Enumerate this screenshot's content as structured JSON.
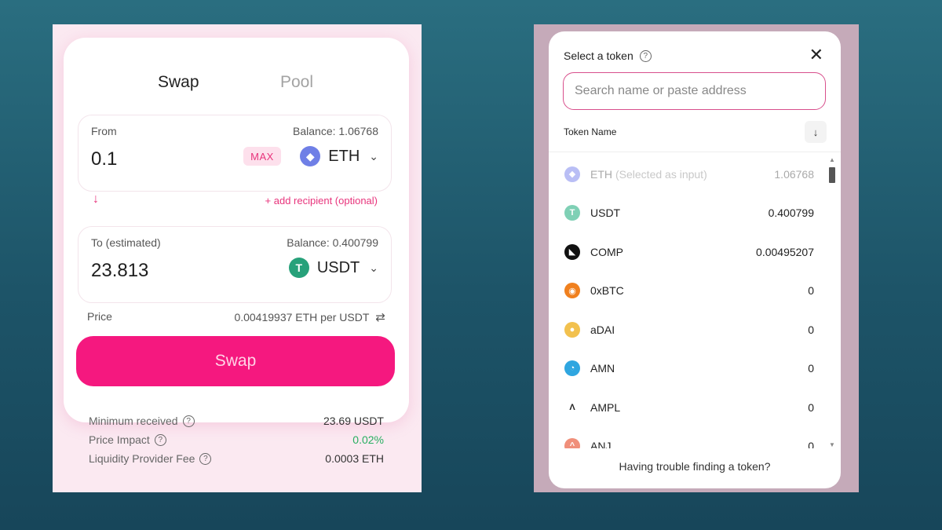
{
  "swap": {
    "tabs": [
      {
        "label": "Swap"
      },
      {
        "label": "Pool"
      }
    ],
    "from": {
      "label": "From",
      "balance": "Balance: 1.06768",
      "amount": "0.1",
      "max_label": "MAX",
      "token": "ETH",
      "token_icon": "eth-icon",
      "token_color": "#6f7fe6"
    },
    "arrow_icon": "arrow-down-icon",
    "add_recipient": "+ add recipient (optional)",
    "to": {
      "label": "To (estimated)",
      "balance": "Balance: 0.400799",
      "amount": "23.813",
      "token": "USDT",
      "token_icon": "usdt-icon",
      "token_color": "#27a17a"
    },
    "price": {
      "label": "Price",
      "value": "0.00419937 ETH per USDT"
    },
    "swap_button": "Swap",
    "accent_color": "#f5187f",
    "summary": [
      {
        "label": "Minimum received",
        "value": "23.69 USDT"
      },
      {
        "label": "Price Impact",
        "value": "0.02%"
      },
      {
        "label": "Liquidity Provider Fee",
        "value": "0.0003 ETH"
      }
    ]
  },
  "token_modal": {
    "title": "Select a token",
    "search_placeholder": "Search name or paste address",
    "list_header": "Token Name",
    "tokens": [
      {
        "symbol": "ETH",
        "note": "(Selected as input)",
        "balance": "1.06768",
        "color": "#b9bef5",
        "glyph": "◆"
      },
      {
        "symbol": "USDT",
        "note": "",
        "balance": "0.400799",
        "color": "#7fd0b5",
        "glyph": "T"
      },
      {
        "symbol": "COMP",
        "note": "",
        "balance": "0.00495207",
        "color": "#111111",
        "glyph": "◣"
      },
      {
        "symbol": "0xBTC",
        "note": "",
        "balance": "0",
        "color": "#f0801e",
        "glyph": "◉"
      },
      {
        "symbol": "aDAI",
        "note": "",
        "balance": "0",
        "color": "#f2c14e",
        "glyph": "●"
      },
      {
        "symbol": "AMN",
        "note": "",
        "balance": "0",
        "color": "#2fa6e0",
        "glyph": "◔"
      },
      {
        "symbol": "AMPL",
        "note": "",
        "balance": "0",
        "color": "#ffffff",
        "glyph": "Λ"
      },
      {
        "symbol": "ANJ",
        "note": "",
        "balance": "0",
        "color": "#f08f7a",
        "glyph": "^"
      }
    ],
    "footer": "Having trouble finding a token?"
  }
}
